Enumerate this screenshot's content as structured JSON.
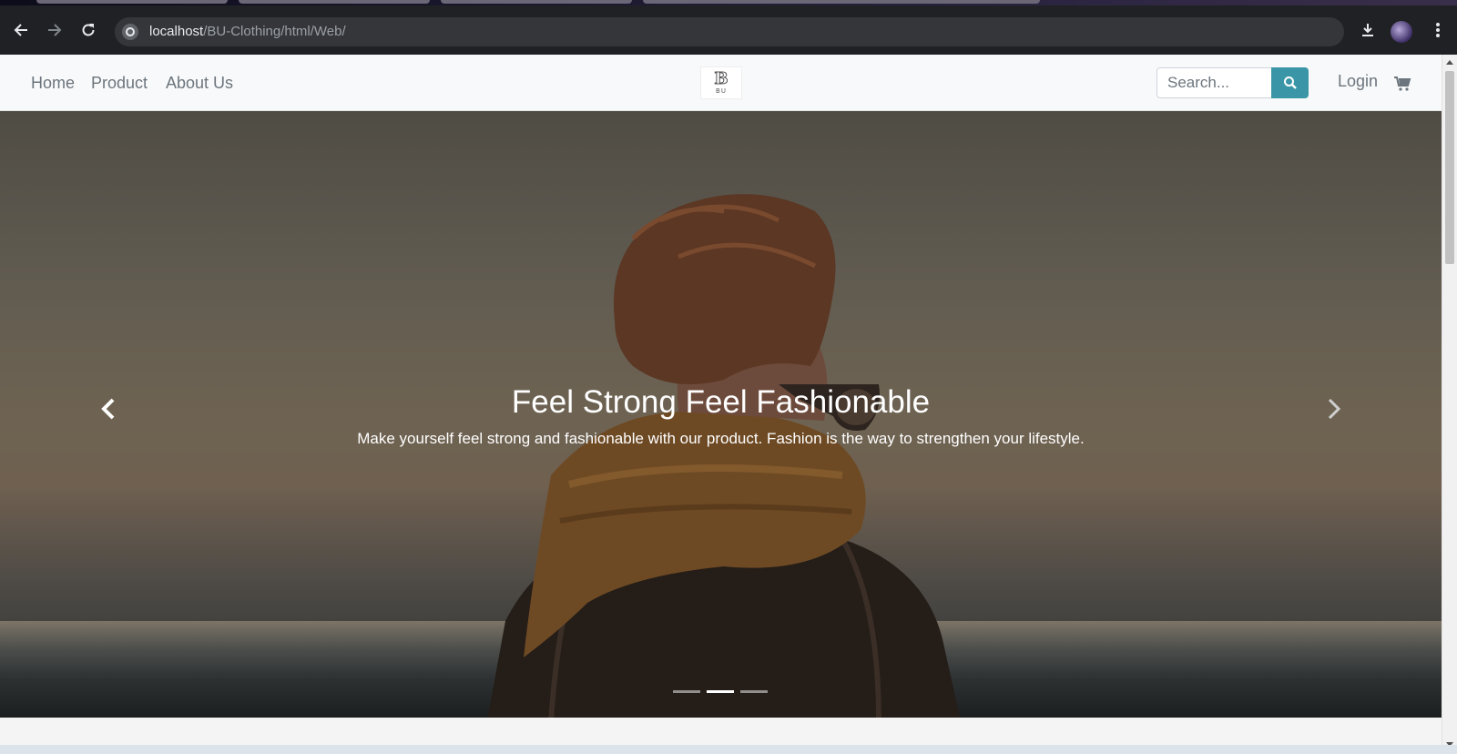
{
  "browser": {
    "url_host": "localhost",
    "url_path": "/BU-Clothing/html/Web/"
  },
  "navbar": {
    "links": [
      "Home",
      "Product",
      "About Us"
    ],
    "logo_letter": "B",
    "logo_sub": "BU",
    "search_placeholder": "Search...",
    "login_label": "Login"
  },
  "hero": {
    "title": "Feel Strong Feel Fashionable",
    "text": "Make yourself feel strong and fashionable with our product. Fashion is the way to strengthen your lifestyle.",
    "slide_count": 3,
    "active_slide": 2
  },
  "colors": {
    "search_button": "#3a96a6",
    "nav_text": "#6c757d",
    "navbar_bg": "#f8f9fa"
  },
  "icons": [
    "back-arrow-icon",
    "forward-arrow-icon",
    "reload-icon",
    "site-info-icon",
    "download-icon",
    "menu-dots-icon",
    "search-icon",
    "cart-icon",
    "chevron-left-icon",
    "chevron-right-icon"
  ]
}
